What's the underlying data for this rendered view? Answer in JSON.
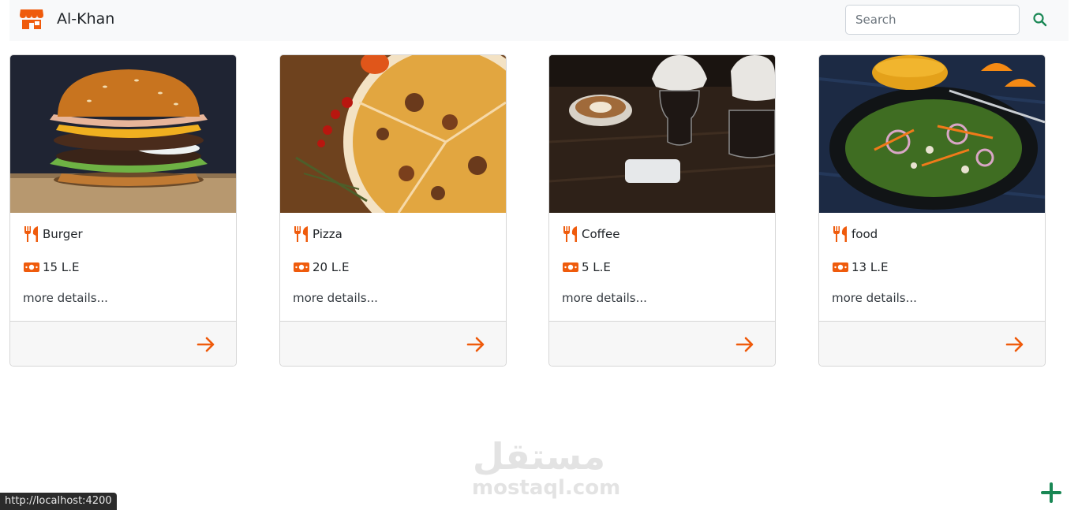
{
  "header": {
    "brand": "Al-Khan",
    "brand_icon": "store-icon",
    "search_placeholder": "Search",
    "search_value": "",
    "search_icon": "search-icon",
    "colors": {
      "accent": "#ef5b0c",
      "search_icon": "#198754",
      "nav_bg": "#f8f9fa"
    }
  },
  "cards": [
    {
      "name": "Burger",
      "price": "15 L.E",
      "details": "more details...",
      "image": "burger-photo"
    },
    {
      "name": "Pizza",
      "price": "20 L.E",
      "details": "more details...",
      "image": "pizza-photo"
    },
    {
      "name": "Coffee",
      "price": "5 L.E",
      "details": "more details...",
      "image": "coffee-photo"
    },
    {
      "name": "food",
      "price": "13 L.E",
      "details": "more details...",
      "image": "salad-photo"
    }
  ],
  "watermark": {
    "arabic": "مستقل",
    "latin": "mostaql.com"
  },
  "statusbar": {
    "url": "http://localhost:4200"
  },
  "fab": {
    "icon": "plus-icon",
    "color": "#198754"
  }
}
